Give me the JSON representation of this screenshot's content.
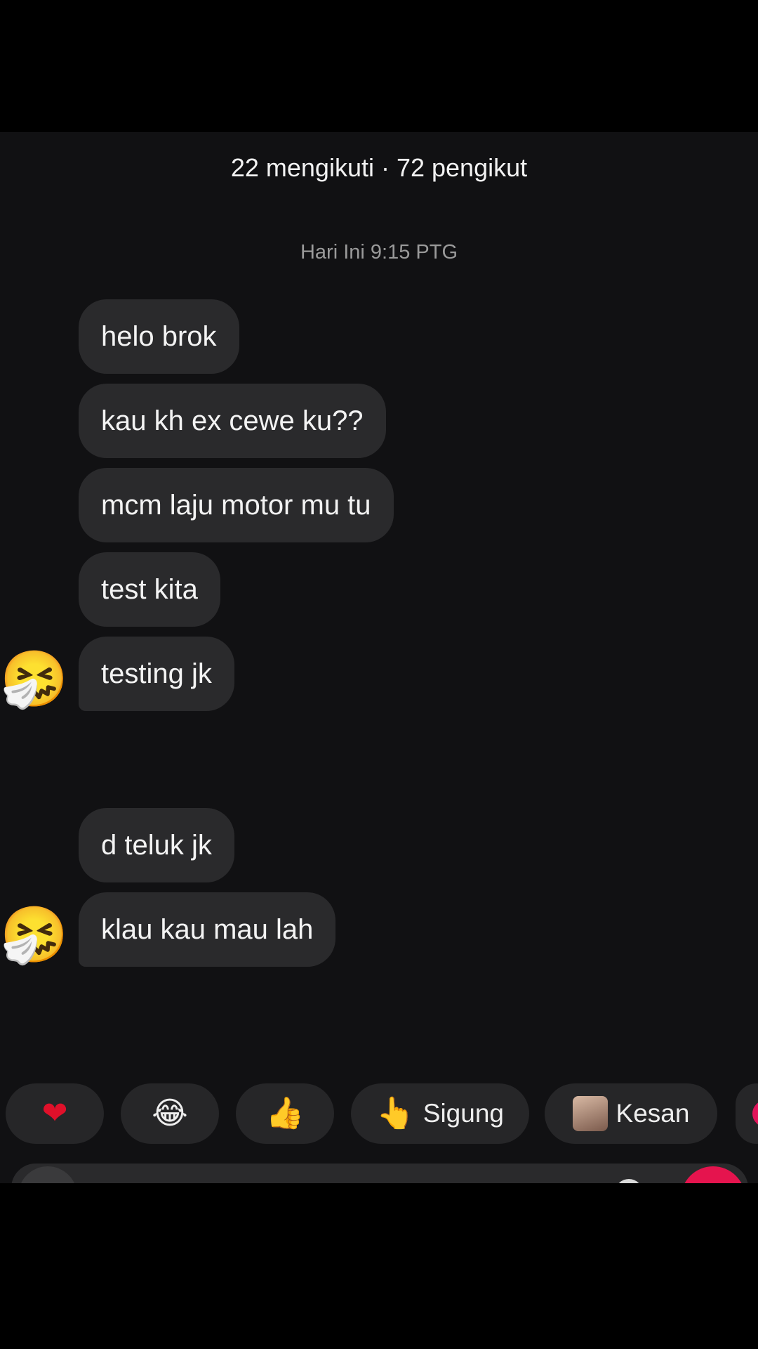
{
  "header": {
    "follow_stats": "22 mengikuti · 72 pengikut"
  },
  "timestamp": "Hari Ini 9:15 PTG",
  "messages": [
    {
      "text": "helo brok"
    },
    {
      "text": "kau kh ex cewe ku??"
    },
    {
      "text": "mcm laju motor mu tu"
    },
    {
      "text": "test kita"
    },
    {
      "text": "testing jk",
      "avatar_icon": "sneezing-face-emoji"
    },
    {
      "text": "d teluk jk"
    },
    {
      "text": "klau kau mau lah",
      "avatar_icon": "sneezing-face-emoji"
    }
  ],
  "quick_reactions": [
    {
      "icon": "heart-emoji",
      "glyph": "❤"
    },
    {
      "icon": "tears-of-joy-emoji",
      "glyph": "😂"
    },
    {
      "icon": "thumbs-up-emoji",
      "glyph": "👍"
    },
    {
      "icon": "pointing-hand-emoji",
      "glyph": "👆",
      "label": "Sigung"
    },
    {
      "icon": "photo-thumbnail",
      "label": "Kesan"
    }
  ],
  "avatar_glyph": "🤧",
  "colors": {
    "background": "#111113",
    "bubble": "#2a2a2c",
    "accent": "#e5144e"
  }
}
